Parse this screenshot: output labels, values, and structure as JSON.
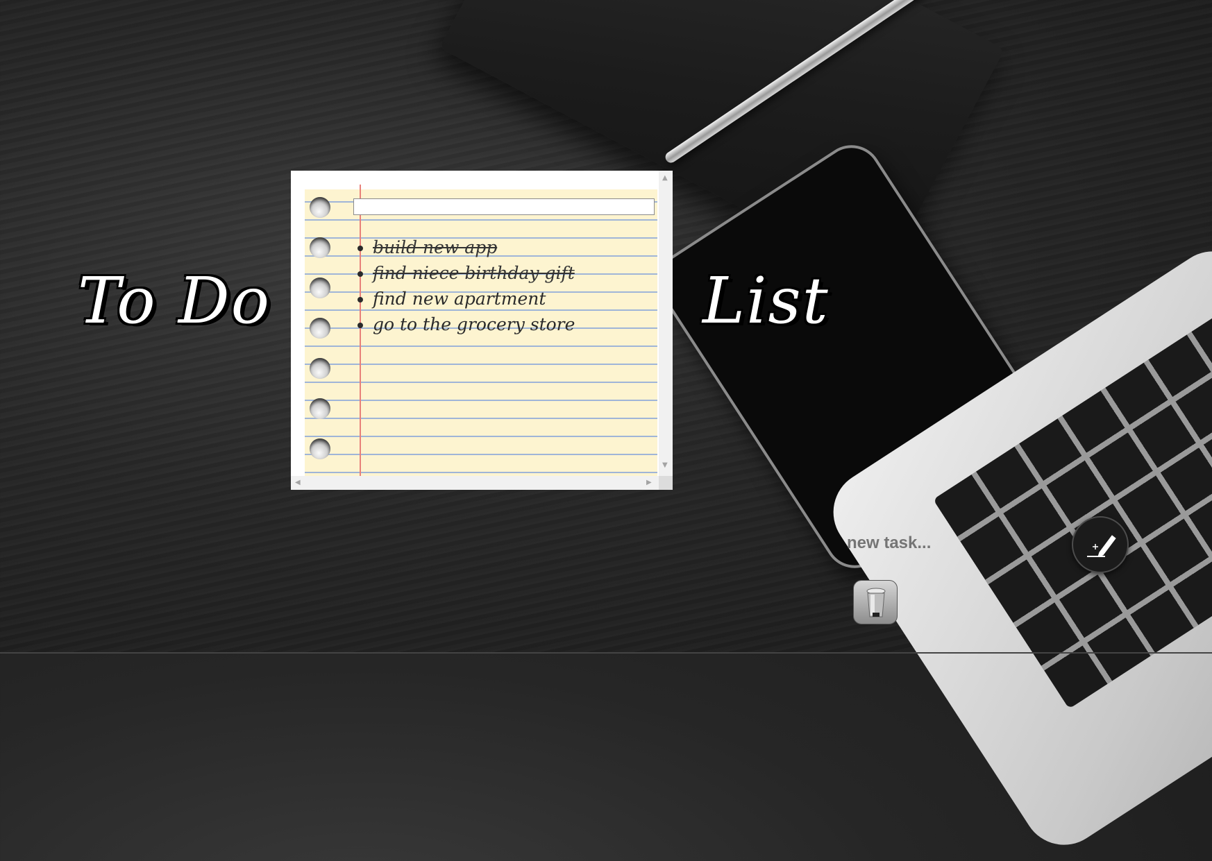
{
  "title": {
    "left": "To Do",
    "right": "List"
  },
  "task_input": {
    "value": ""
  },
  "tasks": [
    {
      "text": "build new app",
      "done": true
    },
    {
      "text": "find niece birthday gift",
      "done": true
    },
    {
      "text": "find new apartment",
      "done": false
    },
    {
      "text": "go to the grocery store",
      "done": false
    }
  ],
  "controls": {
    "new_task_placeholder": "new task...",
    "add_icon": "pencil-add-icon",
    "delete_icon": "trash-can-icon"
  },
  "colors": {
    "paper": "#fdf4d0",
    "rule_line": "#9fb5d8",
    "margin_line": "#e8807a"
  }
}
